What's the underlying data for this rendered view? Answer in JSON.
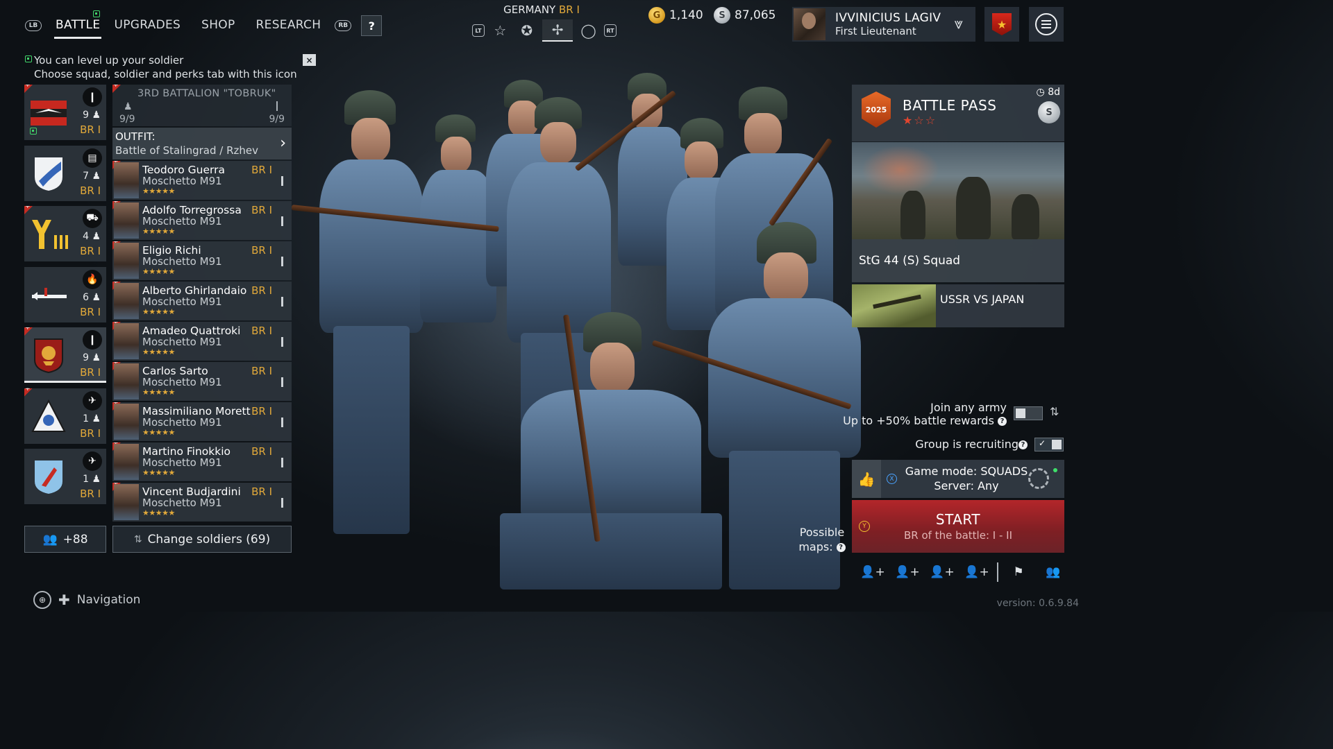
{
  "topbar": {
    "lb": "LB",
    "rb": "RB",
    "tabs": [
      {
        "label": "BATTLE",
        "active": true
      },
      {
        "label": "UPGRADES"
      },
      {
        "label": "SHOP"
      },
      {
        "label": "RESEARCH"
      }
    ],
    "help": "?",
    "country": "GERMANY",
    "country_br": "BR I",
    "lt": "LT",
    "rt": "RT",
    "gold": "1,140",
    "silver": "87,065",
    "gold_symbol": "G",
    "silver_symbol": "S"
  },
  "profile": {
    "name": "IVVINICIUS LAGIV",
    "rank": "First Lieutenant"
  },
  "tip": {
    "line1": "You can level up your soldier",
    "line2": "Choose squad, soldier and perks tab with this icon",
    "close": "×"
  },
  "squads": [
    {
      "count": "9",
      "br": "BR I",
      "emblem": "eagle-banner"
    },
    {
      "count": "7",
      "br": "BR I",
      "emblem": "shield"
    },
    {
      "count": "4",
      "br": "BR I",
      "emblem": "yiii"
    },
    {
      "count": "6",
      "br": "BR I",
      "emblem": "plane"
    },
    {
      "count": "9",
      "br": "BR I",
      "emblem": "lion"
    },
    {
      "count": "1",
      "br": "BR I",
      "emblem": "triangle"
    },
    {
      "count": "1",
      "br": "BR I",
      "emblem": "blue-shield"
    }
  ],
  "squad_detail": {
    "name": "3RD BATTALION \"TOBRUK\"",
    "left_count": "9/9",
    "right_count": "9/9",
    "outfit_label": "OUTFIT:",
    "outfit_value": "Battle of Stalingrad / Rzhev"
  },
  "soldiers": [
    {
      "name": "Teodoro Guerra",
      "weapon": "Moschetto M91",
      "br": "BR I"
    },
    {
      "name": "Adolfo Torregrossa",
      "weapon": "Moschetto M91",
      "br": "BR I"
    },
    {
      "name": "Eligio Richi",
      "weapon": "Moschetto M91",
      "br": "BR I"
    },
    {
      "name": "Alberto Ghirlandaio",
      "weapon": "Moschetto M91",
      "br": "BR I"
    },
    {
      "name": "Amadeo Quattroki",
      "weapon": "Moschetto M91",
      "br": "BR I"
    },
    {
      "name": "Carlos Sarto",
      "weapon": "Moschetto M91",
      "br": "BR I"
    },
    {
      "name": "Massimiliano Morett",
      "weapon": "Moschetto M91",
      "br": "BR I"
    },
    {
      "name": "Martino Finokkio",
      "weapon": "Moschetto M91",
      "br": "BR I"
    },
    {
      "name": "Vincent Budjardini",
      "weapon": "Moschetto M91",
      "br": "BR I"
    }
  ],
  "stars": "★★★★★",
  "bottom": {
    "reserve": "+88",
    "change": "Change soldiers (69)",
    "navigation": "Navigation"
  },
  "battle_pass": {
    "title": "BATTLE PASS",
    "stars": "★☆☆",
    "days": "8d",
    "logo_year": "2025",
    "reward": "StG 44 (S) Squad",
    "event": "USSR VS JAPAN"
  },
  "options": {
    "join_army": "Join any army",
    "join_bonus": "Up to +50% battle rewards",
    "group_recruiting": "Group is recruiting"
  },
  "gamemode": {
    "mode": "Game mode: SQUADS",
    "server": "Server: Any",
    "x": "X"
  },
  "start": {
    "label": "START",
    "br_range": "BR of the battle: I - II",
    "y": "Y",
    "possible_maps": "Possible maps:"
  },
  "version": "version: 0.6.9.84",
  "colors": {
    "accent_gold": "#e2a93a",
    "start_red": "#b3262a",
    "green": "#42d66b"
  }
}
